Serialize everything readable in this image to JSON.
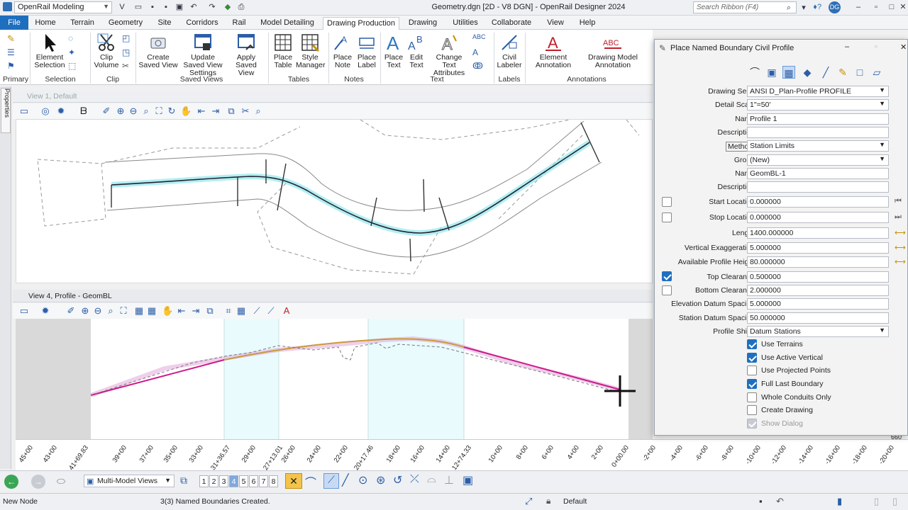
{
  "title_bar": {
    "workspace": "OpenRail Modeling",
    "window_title": "Geometry.dgn [2D - V8 DGN] - OpenRail Designer 2024",
    "search_placeholder": "Search Ribbon (F4)",
    "user_initials": "DG"
  },
  "tabs": [
    "File",
    "Home",
    "Terrain",
    "Geometry",
    "Site",
    "Corridors",
    "Rail",
    "Model Detailing",
    "Drawing Production",
    "Drawing",
    "Utilities",
    "Collaborate",
    "View",
    "Help"
  ],
  "ribbon": {
    "buttons": {
      "element_selection": "Element Selection",
      "clip_volume": "Clip Volume",
      "create_saved_view": "Create Saved View",
      "update_saved_view": "Update Saved View Settings",
      "apply_saved_view": "Apply Saved View",
      "place_table": "Place Table",
      "style_manager": "Style Manager",
      "place_note": "Place Note",
      "place_label": "Place Label",
      "place_text": "Place Text",
      "edit_text": "Edit Text",
      "change_text_attributes": "Change Text Attributes",
      "civil_labeler": "Civil Labeler",
      "element_annotation": "Element Annotation",
      "drawing_model_annotation": "Drawing Model Annotation"
    },
    "groups": {
      "primary": "Primary",
      "selection": "Selection",
      "clip": "Clip",
      "saved_views": "Saved Views",
      "tables": "Tables",
      "notes": "Notes",
      "text": "Text",
      "labels": "Labels",
      "annotations": "Annotations"
    }
  },
  "sidebar": {
    "properties": "Properties"
  },
  "view1": {
    "title": "View 1, Default"
  },
  "view4": {
    "title": "View 4, Profile - GeomBL"
  },
  "profile_ruler": [
    "45+00",
    "43+00",
    "41+69.83",
    "39+00",
    "37+00",
    "35+00",
    "33+00",
    "31+36.57",
    "29+00",
    "27+13.01",
    "26+00",
    "24+00",
    "22+00",
    "20+17.46",
    "18+00",
    "16+00",
    "14+00",
    "12+74.33",
    "10+00",
    "8+00",
    "6+00",
    "4+00",
    "2+00",
    "0+00.00",
    "-2+00",
    "-4+00",
    "-6+00",
    "-8+00",
    "-10+00",
    "-12+00",
    "-14+00",
    "-16+00",
    "-18+00",
    "-20+00"
  ],
  "bottom_toolbar": {
    "multi_model_views": "Multi-Model Views",
    "view_numbers": [
      "1",
      "2",
      "3",
      "4",
      "5",
      "6",
      "7",
      "8"
    ],
    "active_view": "4"
  },
  "status": {
    "left": "New Node",
    "message": "3(3) Named Boundaries Created.",
    "level": "Default"
  },
  "dialog": {
    "title": "Place Named Boundary Civil Profile",
    "fields": {
      "drawing_seed": {
        "label": "Drawing Seed:",
        "value": "ANSI D_Plan-Profile PROFILE"
      },
      "detail_scale": {
        "label": "Detail Scale:",
        "value": "1\"=50'"
      },
      "name1": {
        "label": "Name:",
        "value": "Profile 1"
      },
      "description1": {
        "label": "Description:",
        "value": ""
      },
      "method": {
        "label": "Method:",
        "value": "Station Limits"
      },
      "group": {
        "label": "Group:",
        "value": "(New)"
      },
      "name2": {
        "label": "Name:",
        "value": "GeomBL-1"
      },
      "description2": {
        "label": "Description:",
        "value": ""
      },
      "start_location": {
        "label": "Start Location:",
        "value": "0.000000"
      },
      "stop_location": {
        "label": "Stop Location:",
        "value": "0.000000"
      },
      "length": {
        "label": "Length:",
        "value": "1400.000000"
      },
      "vertical_exaggeration": {
        "label": "Vertical Exaggeration:",
        "value": "5.000000"
      },
      "available_profile_height": {
        "label": "Available Profile Height:",
        "value": "80.000000"
      },
      "top_clearance": {
        "label": "Top Clearance:",
        "value": "0.500000"
      },
      "bottom_clearance": {
        "label": "Bottom Clearance:",
        "value": "2.000000"
      },
      "elevation_datum_spacing": {
        "label": "Elevation Datum Spacing:",
        "value": "5.000000"
      },
      "station_datum_spacing": {
        "label": "Station Datum Spacing:",
        "value": "50.000000"
      },
      "profile_shifts": {
        "label": "Profile Shifts:",
        "value": "Datum Stations"
      }
    },
    "checkboxes": [
      {
        "label": "Use Terrains",
        "checked": true
      },
      {
        "label": "Use Active Vertical",
        "checked": true
      },
      {
        "label": "Use Projected Points",
        "checked": false
      },
      {
        "label": "Full Last Boundary",
        "checked": true
      },
      {
        "label": "Whole Conduits Only",
        "checked": false
      },
      {
        "label": "Create Drawing",
        "checked": false
      },
      {
        "label": "Show Dialog",
        "checked": true,
        "disabled": true
      }
    ],
    "top_clearance_checked": true,
    "bottom_clearance_checked": false
  }
}
